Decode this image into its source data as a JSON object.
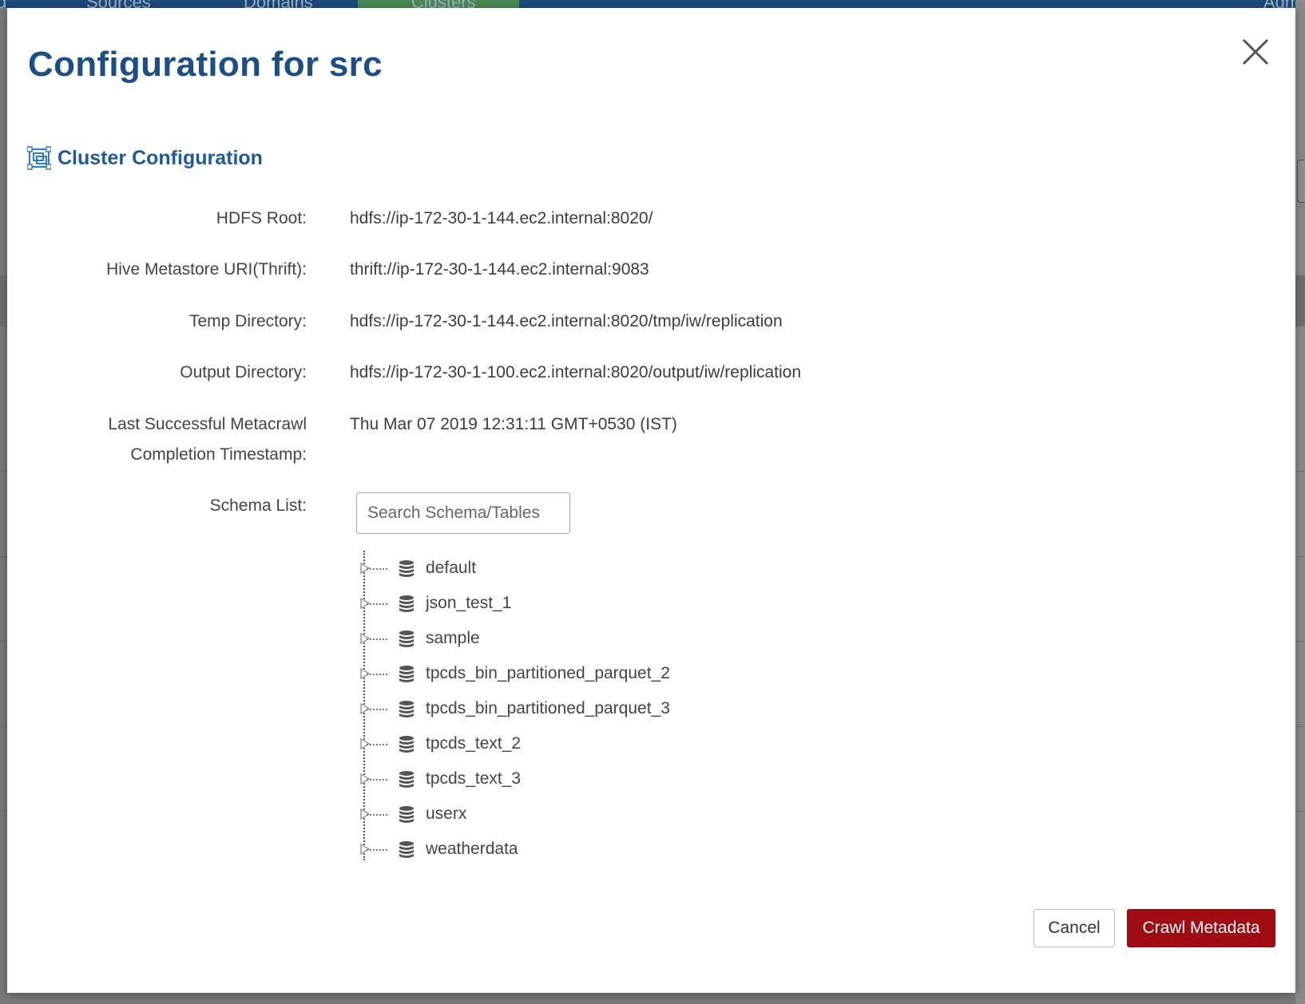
{
  "background": {
    "nav": [
      "d",
      "Sources",
      "Domains",
      "Clusters",
      "Adm"
    ]
  },
  "modal": {
    "title": "Configuration for src",
    "section_title": "Cluster Configuration",
    "fields": {
      "hdfs_root": {
        "label": "HDFS Root:",
        "value": "hdfs://ip-172-30-1-144.ec2.internal:8020/"
      },
      "hive_uri": {
        "label": "Hive Metastore URI(Thrift):",
        "value": "thrift://ip-172-30-1-144.ec2.internal:9083"
      },
      "temp_dir": {
        "label": "Temp Directory:",
        "value": "hdfs://ip-172-30-1-144.ec2.internal:8020/tmp/iw/replication"
      },
      "output_dir": {
        "label": "Output Directory:",
        "value": "hdfs://ip-172-30-1-100.ec2.internal:8020/output/iw/replication"
      },
      "last_crawl": {
        "label_line1": "Last Successful Metacrawl",
        "label_line2": "Completion Timestamp:",
        "value": "Thu Mar 07 2019 12:31:11 GMT+0530 (IST)"
      }
    },
    "schema_list": {
      "label": "Schema List:",
      "search_placeholder": "Search Schema/Tables",
      "search_value": "",
      "items": [
        "default",
        "json_test_1",
        "sample",
        "tpcds_bin_partitioned_parquet_2",
        "tpcds_bin_partitioned_parquet_3",
        "tpcds_text_2",
        "tpcds_text_3",
        "userx",
        "weatherdata"
      ]
    },
    "buttons": {
      "cancel": "Cancel",
      "crawl": "Crawl Metadata"
    },
    "colors": {
      "title": "#1b4f86",
      "section": "#1e5c99",
      "primary_button": "#a00c13"
    }
  }
}
